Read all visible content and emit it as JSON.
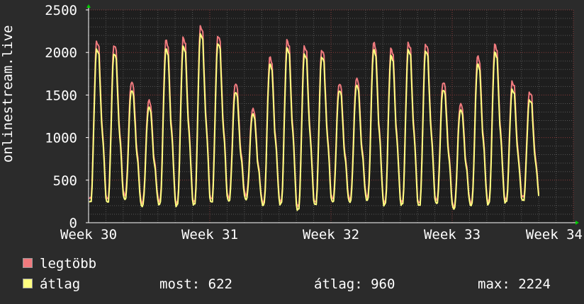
{
  "chart_data": {
    "type": "line",
    "ylabel": "onlinestream.live",
    "ylim": [
      0,
      2500
    ],
    "yticks": [
      0,
      500,
      1000,
      1500,
      2000,
      2500
    ],
    "xlim": [
      30,
      34
    ],
    "xticks": [
      {
        "value": 30,
        "label": "Week 30"
      },
      {
        "value": 31,
        "label": "Week 31"
      },
      {
        "value": 32,
        "label": "Week 32"
      },
      {
        "value": 33,
        "label": "Week 33"
      },
      {
        "value": 34,
        "label": "Week 34"
      }
    ],
    "grid": true,
    "series": [
      {
        "name": "legtöbb",
        "color": "#f07a7e",
        "daily_peaks": [
          2140,
          2100,
          1660,
          1440,
          2150,
          2180,
          2320,
          2210,
          1640,
          1340,
          1950,
          2150,
          2080,
          2040,
          1640,
          1700,
          2120,
          2050,
          2120,
          2110,
          1660,
          1400,
          1960,
          2100,
          1660,
          1540
        ],
        "daily_troughs": [
          280,
          330,
          240,
          260,
          230,
          240,
          280,
          300,
          330,
          240,
          250,
          190,
          240,
          290,
          290,
          310,
          240,
          240,
          230,
          270,
          200,
          240,
          250,
          270,
          300,
          320
        ]
      },
      {
        "name": "átlag",
        "color": "#ffff80",
        "daily_peaks": [
          2050,
          2000,
          1560,
          1360,
          2050,
          2080,
          2230,
          2120,
          1540,
          1280,
          1870,
          2060,
          1990,
          1960,
          1560,
          1620,
          2040,
          1970,
          2040,
          2030,
          1570,
          1330,
          1870,
          2010,
          1570,
          1450
        ],
        "daily_troughs": [
          240,
          280,
          200,
          220,
          200,
          210,
          240,
          260,
          280,
          210,
          220,
          150,
          210,
          250,
          250,
          270,
          210,
          210,
          200,
          230,
          170,
          210,
          220,
          240,
          260,
          290
        ]
      }
    ]
  },
  "legend": {
    "items": [
      {
        "label": "legtöbb",
        "color": "#f07a7e"
      },
      {
        "label": "átlag",
        "color": "#ffff80"
      }
    ],
    "stats": {
      "most": "most: 622",
      "atlag": "átlag: 960",
      "max": "max: 2224"
    }
  }
}
